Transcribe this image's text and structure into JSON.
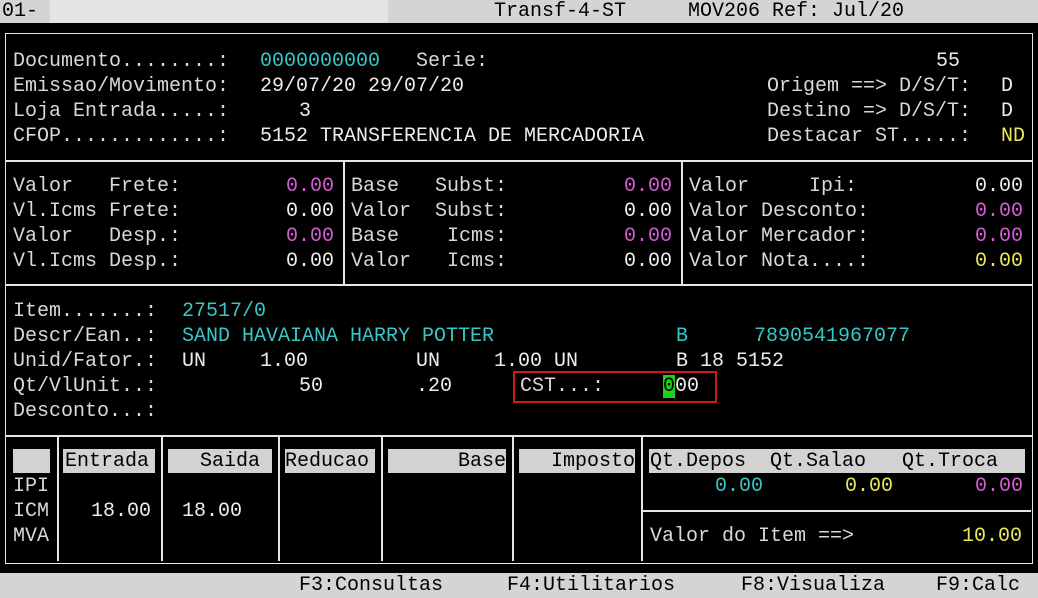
{
  "title_bar": {
    "left": "01-",
    "center": "Transf-4-ST",
    "right": "MOV206 Ref: Jul/20"
  },
  "header": {
    "documento_label": "Documento........:",
    "documento_value": "0000000000",
    "serie_label": "Serie:",
    "serie_value": "55",
    "emissao_label": "Emissao/Movimento:",
    "emissao_value": "29/07/20 29/07/20",
    "origem_label": "Origem ==> D/S/T:",
    "origem_value": "D",
    "loja_label": "Loja Entrada.....:",
    "loja_value": "3",
    "destino_label": "Destino => D/S/T:",
    "destino_value": "D",
    "cfop_label": "CFOP.............:",
    "cfop_value": "5152 TRANSFERENCIA DE MERCADORIA",
    "destacar_label": "Destacar ST.....:",
    "destacar_value": "ND"
  },
  "totals": {
    "col1": [
      {
        "label": "Valor   Frete:",
        "value": "0.00"
      },
      {
        "label": "Vl.Icms Frete:",
        "value": "0.00"
      },
      {
        "label": "Valor   Desp.:",
        "value": "0.00"
      },
      {
        "label": "Vl.Icms Desp.:",
        "value": "0.00"
      }
    ],
    "col2": [
      {
        "label": "Base   Subst:",
        "value": "0.00"
      },
      {
        "label": "Valor  Subst:",
        "value": "0.00"
      },
      {
        "label": "Base    Icms:",
        "value": "0.00"
      },
      {
        "label": "Valor   Icms:",
        "value": "0.00"
      }
    ],
    "col3": [
      {
        "label": "Valor     Ipi:",
        "value": "0.00"
      },
      {
        "label": "Valor Desconto:",
        "value": "0.00"
      },
      {
        "label": "Valor Mercador:",
        "value": "0.00"
      },
      {
        "label": "Valor Nota....:",
        "value": "0.00"
      }
    ]
  },
  "item": {
    "item_label": "Item.......:",
    "item_value": "27517/0",
    "descr_label": "Descr/Ean..:",
    "descr_value": "SAND HAVAIANA HARRY POTTER",
    "descr_flag": "B",
    "ean": "7890541967077",
    "unid_label": "Unid/Fator.:",
    "unid1": "UN",
    "fator1": "1.00",
    "unid2": "UN",
    "fator2": "1.00 UN",
    "unid_tail": "B 18 5152",
    "qt_label": "Qt/VlUnit..:",
    "qt_value": "50",
    "vlunit_value": ".20",
    "cst_label": "CST...:",
    "cst_cursor": "0",
    "cst_rest": "00",
    "desconto_label": "Desconto...:"
  },
  "tax_table": {
    "headers": {
      "entrada": "Entrada",
      "saida": "Saida",
      "reducao": "Reducao",
      "base": "Base",
      "imposto": "Imposto"
    },
    "rows": [
      "IPI",
      "ICM",
      "MVA"
    ],
    "icm_entrada": "18.00",
    "icm_saida": "18.00"
  },
  "stock": {
    "headers": "Qt.Depos  Qt.Salao   Qt.Troca",
    "depos": "0.00",
    "salao": "0.00",
    "troca": "0.00",
    "valor_item_label": "Valor do Item ==>",
    "valor_item_value": "10.00"
  },
  "function_keys": {
    "f3": "F3:Consultas",
    "f4": "F4:Utilitarios",
    "f8": "F8:Visualiza",
    "f9": "F9:Calc"
  },
  "colors": {
    "cyan": "#37c7c7",
    "magenta": "#d65bd6",
    "yellow": "#e8e85a",
    "cursor": "#19d219",
    "highlight": "#d01818"
  }
}
